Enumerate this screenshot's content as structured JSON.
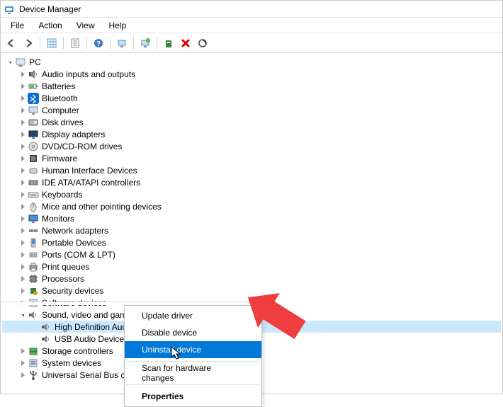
{
  "window": {
    "title": "Device Manager"
  },
  "menubar": {
    "items": [
      "File",
      "Action",
      "View",
      "Help"
    ]
  },
  "toolbar_icons": [
    "back",
    "forward",
    "sep",
    "grid",
    "sep",
    "doc",
    "sep",
    "help",
    "sep",
    "monitor",
    "sep",
    "monitor-plus",
    "sep",
    "monitor-green",
    "sep",
    "green-device",
    "red-x",
    "scan-hw"
  ],
  "tree": {
    "root": {
      "label": "PC",
      "icon": "pc-icon",
      "expanded": true
    },
    "children": [
      {
        "label": "Audio inputs and outputs",
        "icon": "speaker-icon"
      },
      {
        "label": "Batteries",
        "icon": "battery-icon"
      },
      {
        "label": "Bluetooth",
        "icon": "bluetooth-icon"
      },
      {
        "label": "Computer",
        "icon": "computer-icon"
      },
      {
        "label": "Disk drives",
        "icon": "disk-icon"
      },
      {
        "label": "Display adapters",
        "icon": "display-icon"
      },
      {
        "label": "DVD/CD-ROM drives",
        "icon": "dvd-icon"
      },
      {
        "label": "Firmware",
        "icon": "firmware-icon"
      },
      {
        "label": "Human Interface Devices",
        "icon": "hid-icon"
      },
      {
        "label": "IDE ATA/ATAPI controllers",
        "icon": "ide-icon"
      },
      {
        "label": "Keyboards",
        "icon": "keyboard-icon"
      },
      {
        "label": "Mice and other pointing devices",
        "icon": "mouse-icon"
      },
      {
        "label": "Monitors",
        "icon": "monitor-icon"
      },
      {
        "label": "Network adapters",
        "icon": "network-icon"
      },
      {
        "label": "Portable Devices",
        "icon": "portable-icon"
      },
      {
        "label": "Ports (COM & LPT)",
        "icon": "port-icon"
      },
      {
        "label": "Print queues",
        "icon": "printer-icon"
      },
      {
        "label": "Processors",
        "icon": "cpu-icon"
      },
      {
        "label": "Security devices",
        "icon": "security-icon"
      },
      {
        "label": "Software devices",
        "icon": "software-icon"
      },
      {
        "label": "Sound, video and game controllers",
        "icon": "sound-icon",
        "expanded": true,
        "children": [
          {
            "label": "High Definition Audio Device",
            "icon": "audio-device-icon",
            "selected": true,
            "display_label": "High Definition Auc"
          },
          {
            "label": "USB Audio Device",
            "icon": "audio-device-icon"
          }
        ]
      },
      {
        "label": "Storage controllers",
        "icon": "storage-icon"
      },
      {
        "label": "System devices",
        "icon": "system-icon"
      },
      {
        "label": "Universal Serial Bus controllers",
        "icon": "usb-icon",
        "display_label": "Universal Serial Bus co"
      }
    ]
  },
  "context_menu": {
    "items": [
      {
        "label": "Update driver",
        "type": "item"
      },
      {
        "label": "Disable device",
        "type": "item"
      },
      {
        "label": "Uninstall device",
        "type": "item",
        "highlighted": true
      },
      {
        "type": "sep"
      },
      {
        "label": "Scan for hardware changes",
        "type": "item"
      },
      {
        "type": "sep"
      },
      {
        "label": "Properties",
        "type": "item",
        "bold": true
      }
    ]
  }
}
